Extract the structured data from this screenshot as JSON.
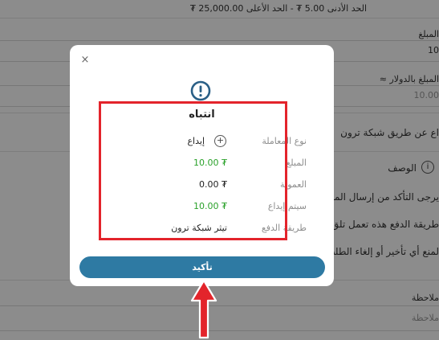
{
  "background": {
    "limits_line": "الحد الأدنى 5.00 ₮  -  الحد الأعلى 25,000.00 ₮",
    "amount_label": "المبلغ",
    "amount_value": "10",
    "usd_label": "المبلغ بالدولار ≈",
    "usd_value": "10.00",
    "tron_fragment": "اع عن طريق شبكة ترون",
    "desc_label": "الوصف",
    "notice_1": "يرجى التأكد من إرسال المبلغ",
    "notice_2": "طريقة الدفع هذه تعمل تلق",
    "notice_3": "لمنع أي تأخير أو إلغاء الطلب",
    "note_label": "ملاحظة",
    "note_placeholder": "ملاحظة"
  },
  "modal": {
    "close_symbol": "×",
    "title": "انتباه",
    "rows": [
      {
        "label": "نوع المعاملة",
        "value": "إيداع",
        "icon": "plus-circle-icon"
      },
      {
        "label": "المبلغ",
        "value": "₮ 10.00"
      },
      {
        "label": "العمولة",
        "value": "₮ 0.00"
      },
      {
        "label": "سيتم إيداع",
        "value": "₮ 10.00"
      },
      {
        "label": "طريقة الدفع",
        "value": "تيثر شبكة ترون"
      }
    ],
    "confirm_label": "تأكيد"
  },
  "colors": {
    "accent": "#2e7aa3",
    "positive": "#2aa12a",
    "highlight": "#e3242b"
  }
}
